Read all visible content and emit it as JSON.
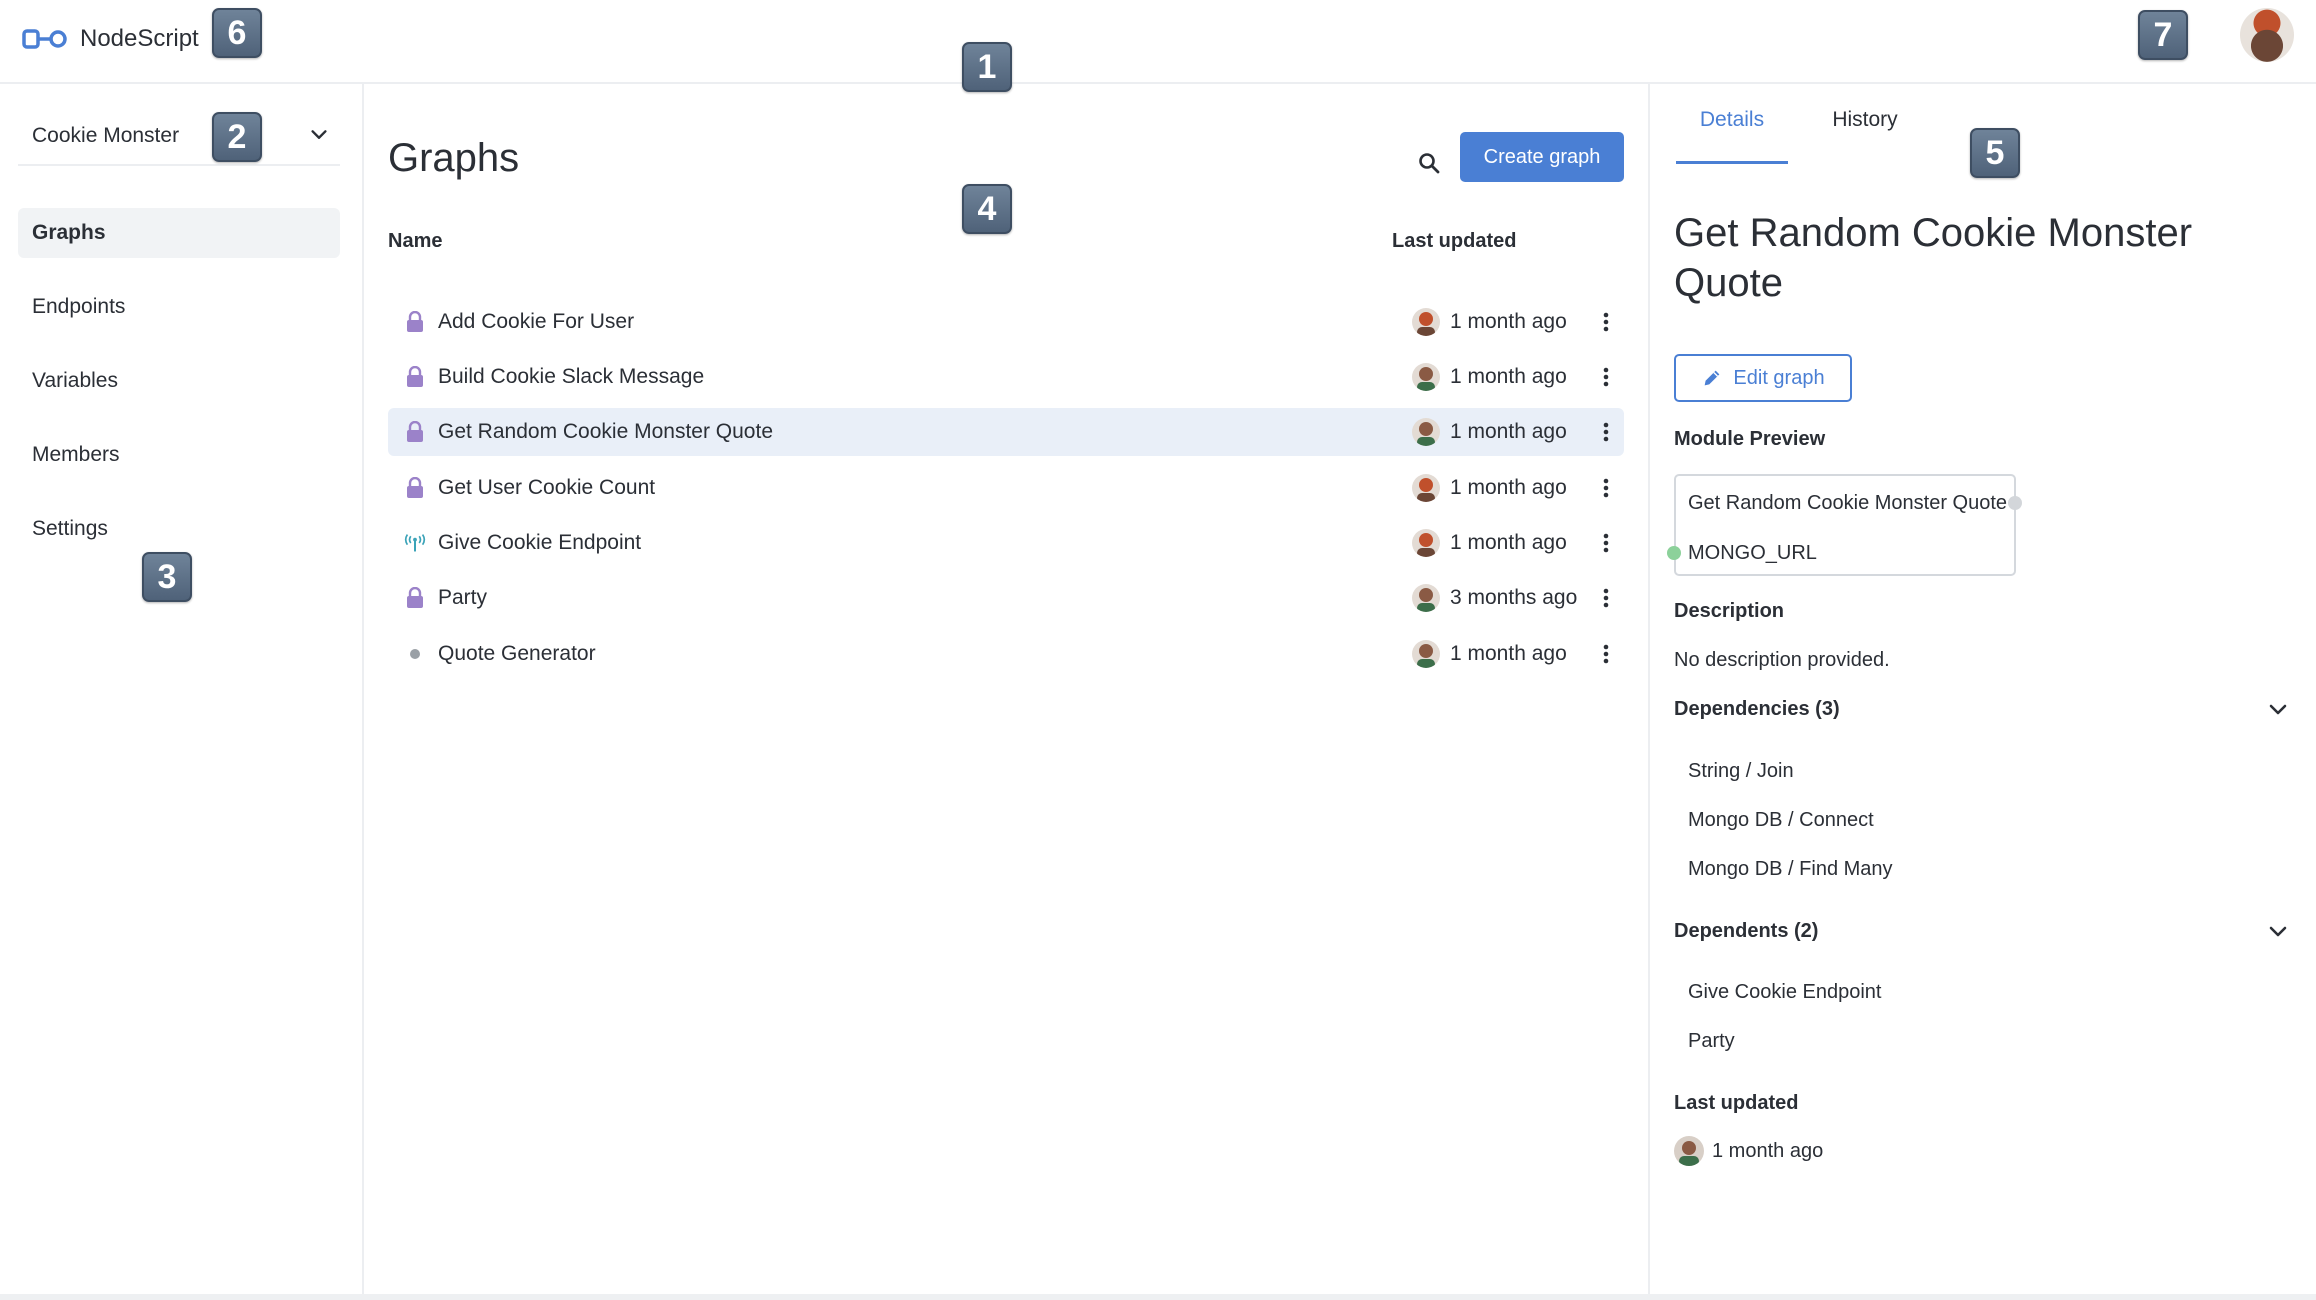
{
  "app": {
    "name": "NodeScript"
  },
  "badges": [
    "1",
    "2",
    "3",
    "4",
    "5",
    "6",
    "7"
  ],
  "sidebar": {
    "workspace": "Cookie Monster",
    "items": [
      {
        "label": "Graphs",
        "active": true
      },
      {
        "label": "Endpoints",
        "active": false
      },
      {
        "label": "Variables",
        "active": false
      },
      {
        "label": "Members",
        "active": false
      },
      {
        "label": "Settings",
        "active": false
      }
    ]
  },
  "main": {
    "title": "Graphs",
    "create_label": "Create graph",
    "columns": {
      "name": "Name",
      "updated": "Last updated"
    },
    "rows": [
      {
        "name": "Add Cookie For User",
        "icon": "lock-icon",
        "updated": "1 month ago"
      },
      {
        "name": "Build Cookie Slack Message",
        "icon": "lock-icon",
        "updated": "1 month ago"
      },
      {
        "name": "Get Random Cookie Monster Quote",
        "icon": "lock-icon",
        "updated": "1 month ago",
        "selected": true
      },
      {
        "name": "Get User Cookie Count",
        "icon": "lock-icon",
        "updated": "1 month ago"
      },
      {
        "name": "Give Cookie Endpoint",
        "icon": "antenna-icon",
        "updated": "1 month ago"
      },
      {
        "name": "Party",
        "icon": "lock-icon",
        "updated": "3 months ago"
      },
      {
        "name": "Quote Generator",
        "icon": "dot-icon",
        "updated": "1 month ago"
      }
    ]
  },
  "details": {
    "tabs": [
      {
        "label": "Details",
        "active": true
      },
      {
        "label": "History",
        "active": false
      }
    ],
    "title": "Get Random Cookie Monster Quote",
    "edit_label": "Edit graph",
    "module_preview_label": "Module Preview",
    "module_preview": {
      "name": "Get Random Cookie Monster Quote",
      "param": "MONGO_URL"
    },
    "description_label": "Description",
    "description": "No description provided.",
    "dependencies_label": "Dependencies (3)",
    "dependencies": [
      "String / Join",
      "Mongo DB / Connect",
      "Mongo DB / Find Many"
    ],
    "dependents_label": "Dependents (2)",
    "dependents": [
      "Give Cookie Endpoint",
      "Party"
    ],
    "last_updated_label": "Last updated",
    "last_updated": "1 month ago"
  },
  "colors": {
    "accent": "#4a7fd4",
    "lock": "#9b82c9",
    "antenna": "#3ba3b8",
    "port_in": "#8cd19a",
    "port_out": "#d3d6da"
  }
}
